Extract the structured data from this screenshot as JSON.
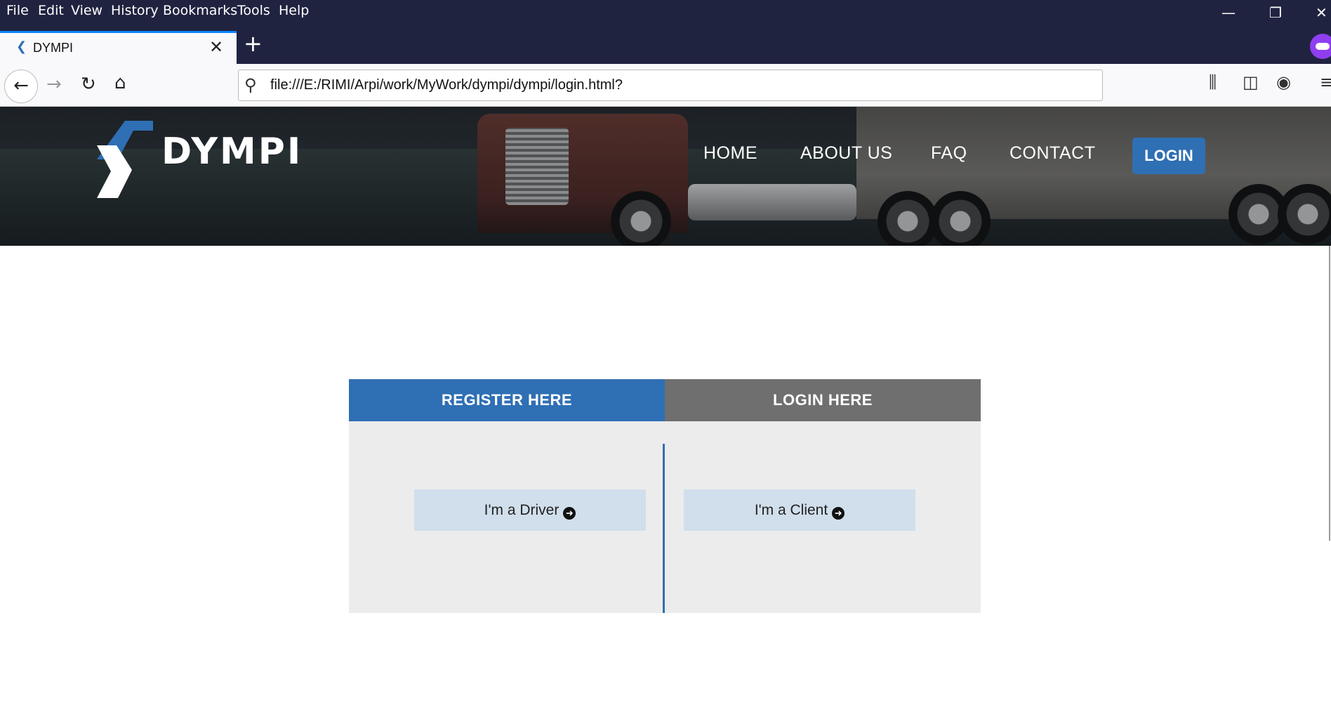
{
  "browser": {
    "menu": [
      "File",
      "Edit",
      "View",
      "History",
      "Bookmarks",
      "Tools",
      "Help"
    ],
    "tab_title": "DYMPI",
    "url": "file:///E:/RIMI/Arpi/work/MyWork/dympi/dympi/login.html?"
  },
  "site": {
    "logo_text": "DYMPI",
    "nav": [
      "HOME",
      "ABOUT US",
      "FAQ",
      "CONTACT"
    ],
    "login_label": "LOGIN"
  },
  "auth_card": {
    "register_tab": "REGISTER HERE",
    "login_tab": "LOGIN HERE",
    "driver_label": "I'm a Driver",
    "client_label": "I'm a Client"
  },
  "colors": {
    "accent": "#2f6fb4",
    "tab_inactive": "#6f6f6f",
    "card_bg": "#ececec",
    "choice_bg": "#d1dfec",
    "browser_bar": "#202340"
  }
}
